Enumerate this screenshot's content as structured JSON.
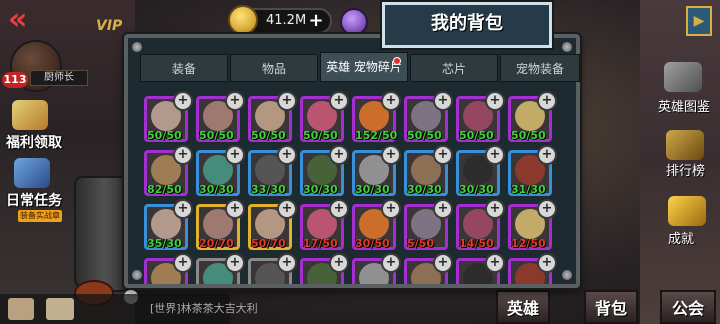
{
  "top": {
    "coins": "41.2M",
    "player_level": "113",
    "player_name": "厨师长",
    "vip": "VIP"
  },
  "panel": {
    "title": "我的背包",
    "tabs": [
      {
        "label": "装备",
        "active": false
      },
      {
        "label": "物品",
        "active": false
      },
      {
        "label": "英雄 宠物碎片",
        "active": true,
        "badge": true
      },
      {
        "label": "芯片",
        "active": false
      },
      {
        "label": "宠物装备",
        "active": false
      }
    ]
  },
  "left_menu": {
    "welfare": "福利领取",
    "daily": "日常任务",
    "daily_sub": "装备实战章"
  },
  "right_menu": {
    "hero_book": "英雄图鉴",
    "rank": "排行榜",
    "achieve": "成就"
  },
  "bottom": {
    "chat_text": "[世界]林茶茶大吉大利",
    "tabs": [
      "英雄",
      "背包",
      "公会"
    ]
  },
  "fragments": [
    {
      "count": "50/50",
      "rarity": "purple",
      "color": "#3fd23a"
    },
    {
      "count": "50/50",
      "rarity": "purple",
      "color": "#3fd23a"
    },
    {
      "count": "50/50",
      "rarity": "purple",
      "color": "#3fd23a"
    },
    {
      "count": "50/50",
      "rarity": "purple",
      "color": "#3fd23a"
    },
    {
      "count": "152/50",
      "rarity": "purple",
      "color": "#3fd23a"
    },
    {
      "count": "50/50",
      "rarity": "purple",
      "color": "#3fd23a"
    },
    {
      "count": "50/50",
      "rarity": "purple",
      "color": "#3fd23a"
    },
    {
      "count": "50/50",
      "rarity": "purple",
      "color": "#3fd23a"
    },
    {
      "count": "82/50",
      "rarity": "purple",
      "color": "#3fd23a"
    },
    {
      "count": "30/30",
      "rarity": "blue",
      "color": "#3fd23a"
    },
    {
      "count": "33/30",
      "rarity": "blue",
      "color": "#3fd23a"
    },
    {
      "count": "30/30",
      "rarity": "blue",
      "color": "#3fd23a"
    },
    {
      "count": "30/30",
      "rarity": "blue",
      "color": "#3fd23a"
    },
    {
      "count": "30/30",
      "rarity": "blue",
      "color": "#3fd23a"
    },
    {
      "count": "30/30",
      "rarity": "blue",
      "color": "#3fd23a"
    },
    {
      "count": "31/30",
      "rarity": "blue",
      "color": "#3fd23a"
    },
    {
      "count": "35/30",
      "rarity": "blue",
      "color": "#3fd23a"
    },
    {
      "count": "20/70",
      "rarity": "gold",
      "color": "#e33a2a"
    },
    {
      "count": "50/70",
      "rarity": "gold",
      "color": "#e33a2a"
    },
    {
      "count": "17/50",
      "rarity": "purple",
      "color": "#e33a2a"
    },
    {
      "count": "30/50",
      "rarity": "purple",
      "color": "#e33a2a"
    },
    {
      "count": "5/50",
      "rarity": "purple",
      "color": "#e33a2a"
    },
    {
      "count": "14/50",
      "rarity": "purple",
      "color": "#e33a2a"
    },
    {
      "count": "12/50",
      "rarity": "purple",
      "color": "#e33a2a"
    },
    {
      "count": "",
      "rarity": "purple",
      "color": "#3fd23a"
    },
    {
      "count": "",
      "rarity": "gray",
      "color": "#3fd23a"
    },
    {
      "count": "",
      "rarity": "gray",
      "color": "#3fd23a"
    },
    {
      "count": "",
      "rarity": "purple",
      "color": "#3fd23a"
    },
    {
      "count": "",
      "rarity": "purple",
      "color": "#3fd23a"
    },
    {
      "count": "",
      "rarity": "purple",
      "color": "#3fd23a"
    },
    {
      "count": "",
      "rarity": "purple",
      "color": "#3fd23a"
    },
    {
      "count": "",
      "rarity": "purple",
      "color": "#3fd23a"
    }
  ],
  "portrait_colors": [
    "#c9a99b",
    "#b0857a",
    "#caa88e",
    "#d05a7a",
    "#e5782a",
    "#8a7e90",
    "#a64a6a",
    "#d9c070",
    "#b08a5a",
    "#4a9a8a",
    "#5a5a5a",
    "#4a6a3a",
    "#a0a0a0",
    "#9a7a5a",
    "#2a2a2a",
    "#9a3a2a"
  ]
}
